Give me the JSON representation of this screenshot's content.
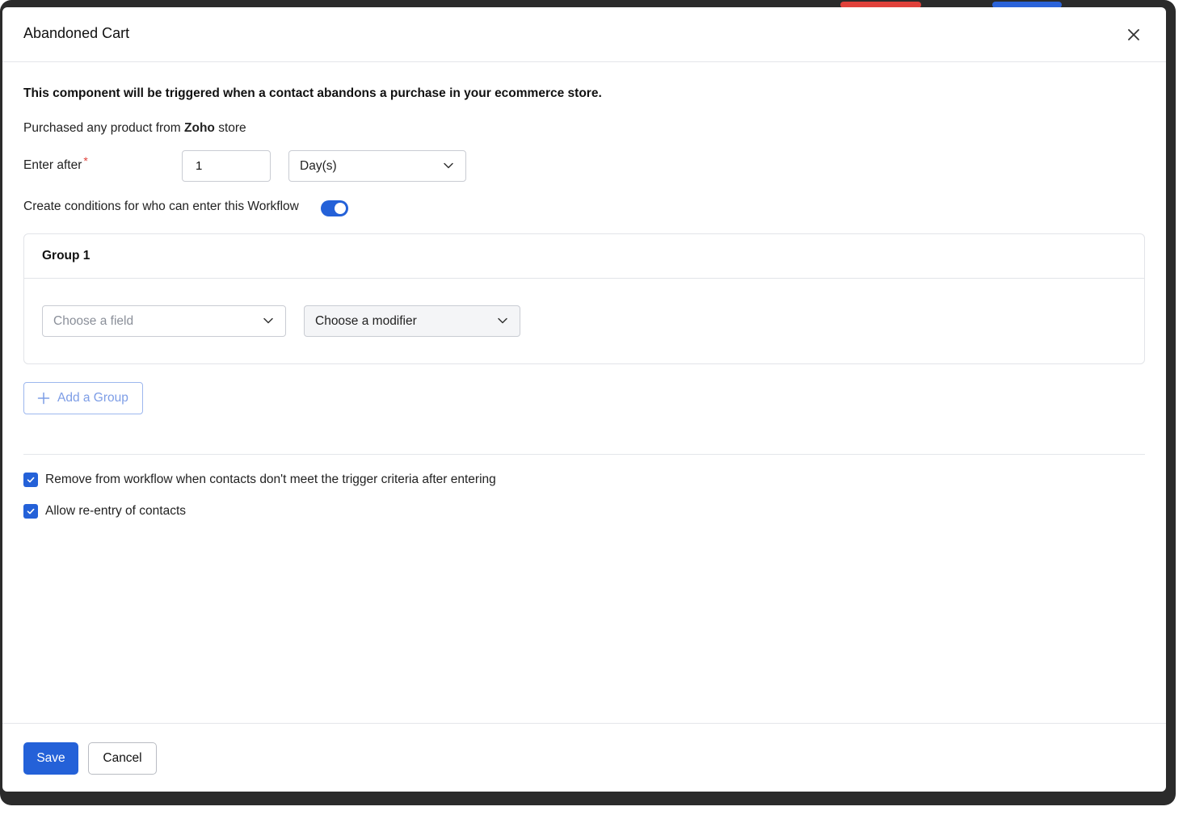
{
  "dialog": {
    "title": "Abandoned Cart",
    "close_icon": "close-icon"
  },
  "content": {
    "intro": "This component will be triggered when a contact abandons a purchase in your ecommerce store.",
    "purchased_prefix": "Purchased any product from ",
    "store_name": "Zoho",
    "purchased_suffix": " store",
    "enter_after_label": "Enter after",
    "required_marker": "*",
    "enter_after_value": "1",
    "enter_after_unit": "Day(s)",
    "conditions_toggle_label": "Create conditions for who can enter this Workflow",
    "conditions_toggle_on": true
  },
  "group": {
    "title": "Group 1",
    "field_placeholder": "Choose a field",
    "modifier_placeholder": "Choose a modifier"
  },
  "add_group_label": "Add a Group",
  "options": [
    {
      "label": "Remove from workflow when contacts don't meet the trigger criteria after entering",
      "checked": true
    },
    {
      "label": "Allow re-entry of contacts",
      "checked": true
    }
  ],
  "footer": {
    "save_label": "Save",
    "cancel_label": "Cancel"
  },
  "colors": {
    "accent": "#2461d8",
    "required": "#e0413a",
    "add_group_text": "#7d9de6"
  }
}
